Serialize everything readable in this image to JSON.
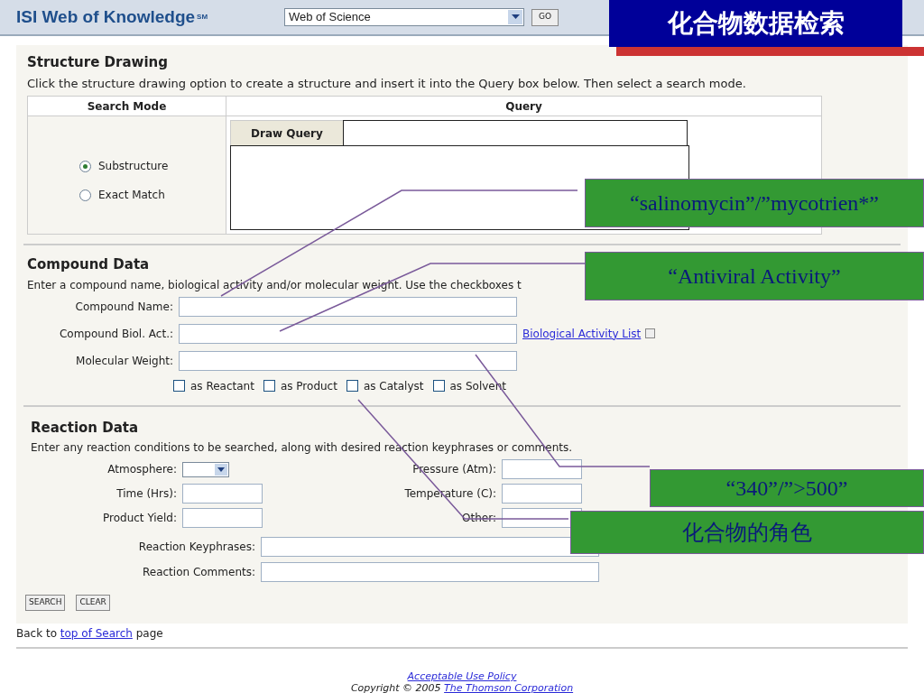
{
  "header": {
    "logo": "ISI Web of Knowledge",
    "logo_mark": "SM",
    "database": "Web of Science",
    "go": "GO"
  },
  "slide_title": "化合物数据检索",
  "structure": {
    "title": "Structure Drawing",
    "hint": "Click the structure drawing option to create a structure and insert it into the Query box below. Then select a search mode.",
    "mode_header": "Search Mode",
    "query_header": "Query",
    "draw_button": "Draw Query",
    "modes": [
      {
        "label": "Substructure",
        "selected": true
      },
      {
        "label": "Exact Match",
        "selected": false
      }
    ]
  },
  "compound": {
    "title": "Compound Data",
    "hint": "Enter a compound name, biological activity and/or molecular weight. Use the checkboxes t",
    "fields": [
      {
        "label": "Compound Name:"
      },
      {
        "label": "Compound Biol. Act.:",
        "link": "Biological Activity List"
      },
      {
        "label": "Molecular Weight:"
      }
    ],
    "roles": [
      {
        "label": "as Reactant",
        "checked": false
      },
      {
        "label": "as Product",
        "checked": false
      },
      {
        "label": "as Catalyst",
        "checked": false
      },
      {
        "label": "as Solvent",
        "checked": false
      }
    ]
  },
  "reaction": {
    "title": "Reaction Data",
    "hint": "Enter any reaction conditions to be searched, along with desired reaction keyphrases or comments.",
    "left": [
      {
        "label": "Atmosphere:",
        "kind": "select"
      },
      {
        "label": "Time (Hrs):",
        "kind": "text"
      },
      {
        "label": "Product Yield:",
        "kind": "text"
      }
    ],
    "right": [
      {
        "label": "Pressure (Atm):"
      },
      {
        "label": "Temperature (C):"
      },
      {
        "label": "Other:"
      }
    ],
    "wide": [
      {
        "label": "Reaction Keyphrases:"
      },
      {
        "label": "Reaction Comments:"
      }
    ],
    "buttons": [
      "SEARCH",
      "CLEAR"
    ]
  },
  "back": {
    "before": "Back to ",
    "link": "top of Search",
    "after": " page"
  },
  "footer": {
    "policy": "Acceptable Use Policy",
    "copyright": "Copyright © 2005 ",
    "company": "The Thomson Corporation"
  },
  "callouts": [
    {
      "text": "“salinomycin”/”mycotrien*”"
    },
    {
      "text": "“Antiviral Activity”"
    },
    {
      "text": "“340”/”>500”"
    },
    {
      "text": "化合物的角色"
    }
  ]
}
